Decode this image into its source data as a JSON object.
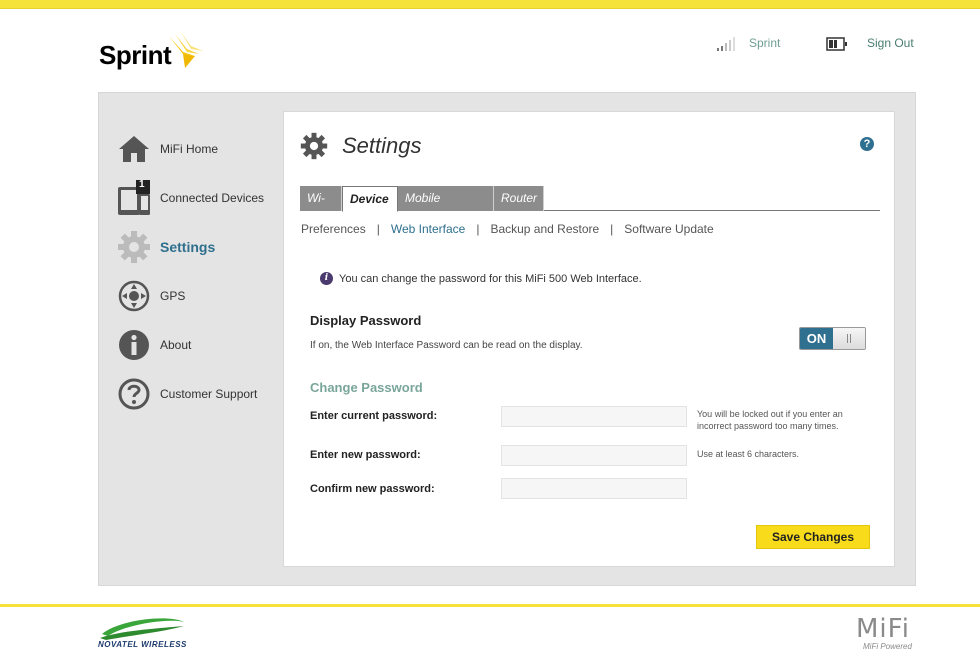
{
  "header": {
    "brand": "Sprint",
    "carrier": "Sprint",
    "sign_out": "Sign Out"
  },
  "sidebar": {
    "items": [
      {
        "label": "MiFi Home",
        "icon": "home-icon"
      },
      {
        "label": "Connected Devices",
        "icon": "devices-icon",
        "badge": "1"
      },
      {
        "label": "Settings",
        "icon": "gear-icon",
        "active": true
      },
      {
        "label": "GPS",
        "icon": "gps-icon"
      },
      {
        "label": "About",
        "icon": "info-icon"
      },
      {
        "label": "Customer Support",
        "icon": "question-icon"
      }
    ]
  },
  "page": {
    "title": "Settings",
    "help": "?",
    "tabs": [
      {
        "label": "Wi-Fi"
      },
      {
        "label": "Device",
        "active": true
      },
      {
        "label": "Mobile Network"
      },
      {
        "label": "Router"
      }
    ],
    "subnav": [
      {
        "label": "Preferences"
      },
      {
        "label": "Web Interface",
        "active": true
      },
      {
        "label": "Backup and Restore"
      },
      {
        "label": "Software Update"
      }
    ],
    "info": "You can change the password for this MiFi 500 Web Interface.",
    "display_password": {
      "title": "Display Password",
      "description": "If on, the Web Interface Password can be read on the display.",
      "toggle_state": "ON"
    },
    "change_password": {
      "title": "Change Password",
      "fields": [
        {
          "label": "Enter current password:",
          "value": "",
          "hint": "You will be locked out if you enter an incorrect password too many times."
        },
        {
          "label": "Enter new password:",
          "value": "",
          "hint": "Use at least 6 characters."
        },
        {
          "label": "Confirm new password:",
          "value": "",
          "hint": ""
        }
      ]
    },
    "save_label": "Save Changes"
  },
  "footer": {
    "left_brand": "NOVATEL WIRELESS",
    "right_brand": "MiFi",
    "right_sub": "MiFi Powered"
  },
  "colors": {
    "accent_yellow": "#f5e33a",
    "active_blue": "#2e6f8e",
    "status_green": "#6e9d92",
    "save_yellow": "#f8dc1c"
  }
}
